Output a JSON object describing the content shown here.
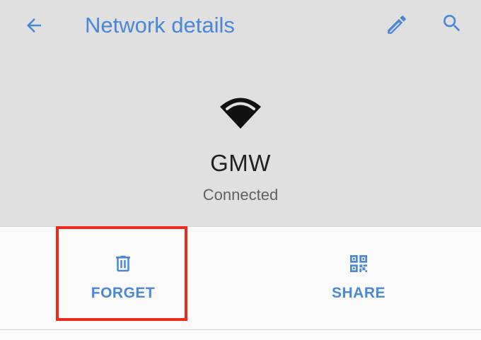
{
  "toolbar": {
    "back_icon": "arrow-back-icon",
    "title": "Network details",
    "edit_icon": "pencil-icon",
    "search_icon": "search-icon"
  },
  "network": {
    "icon": "wifi-icon",
    "name": "GMW",
    "status": "Connected"
  },
  "actions": {
    "forget": {
      "label": "FORGET",
      "icon": "trash-icon"
    },
    "share": {
      "label": "SHARE",
      "icon": "qr-code-icon"
    }
  },
  "colors": {
    "accent": "#4a87d6",
    "header_bg": "#e0e0e0",
    "body_bg": "#fafafa",
    "highlight": "#ee2a1b",
    "text_primary": "#212121",
    "text_secondary": "#616161"
  }
}
